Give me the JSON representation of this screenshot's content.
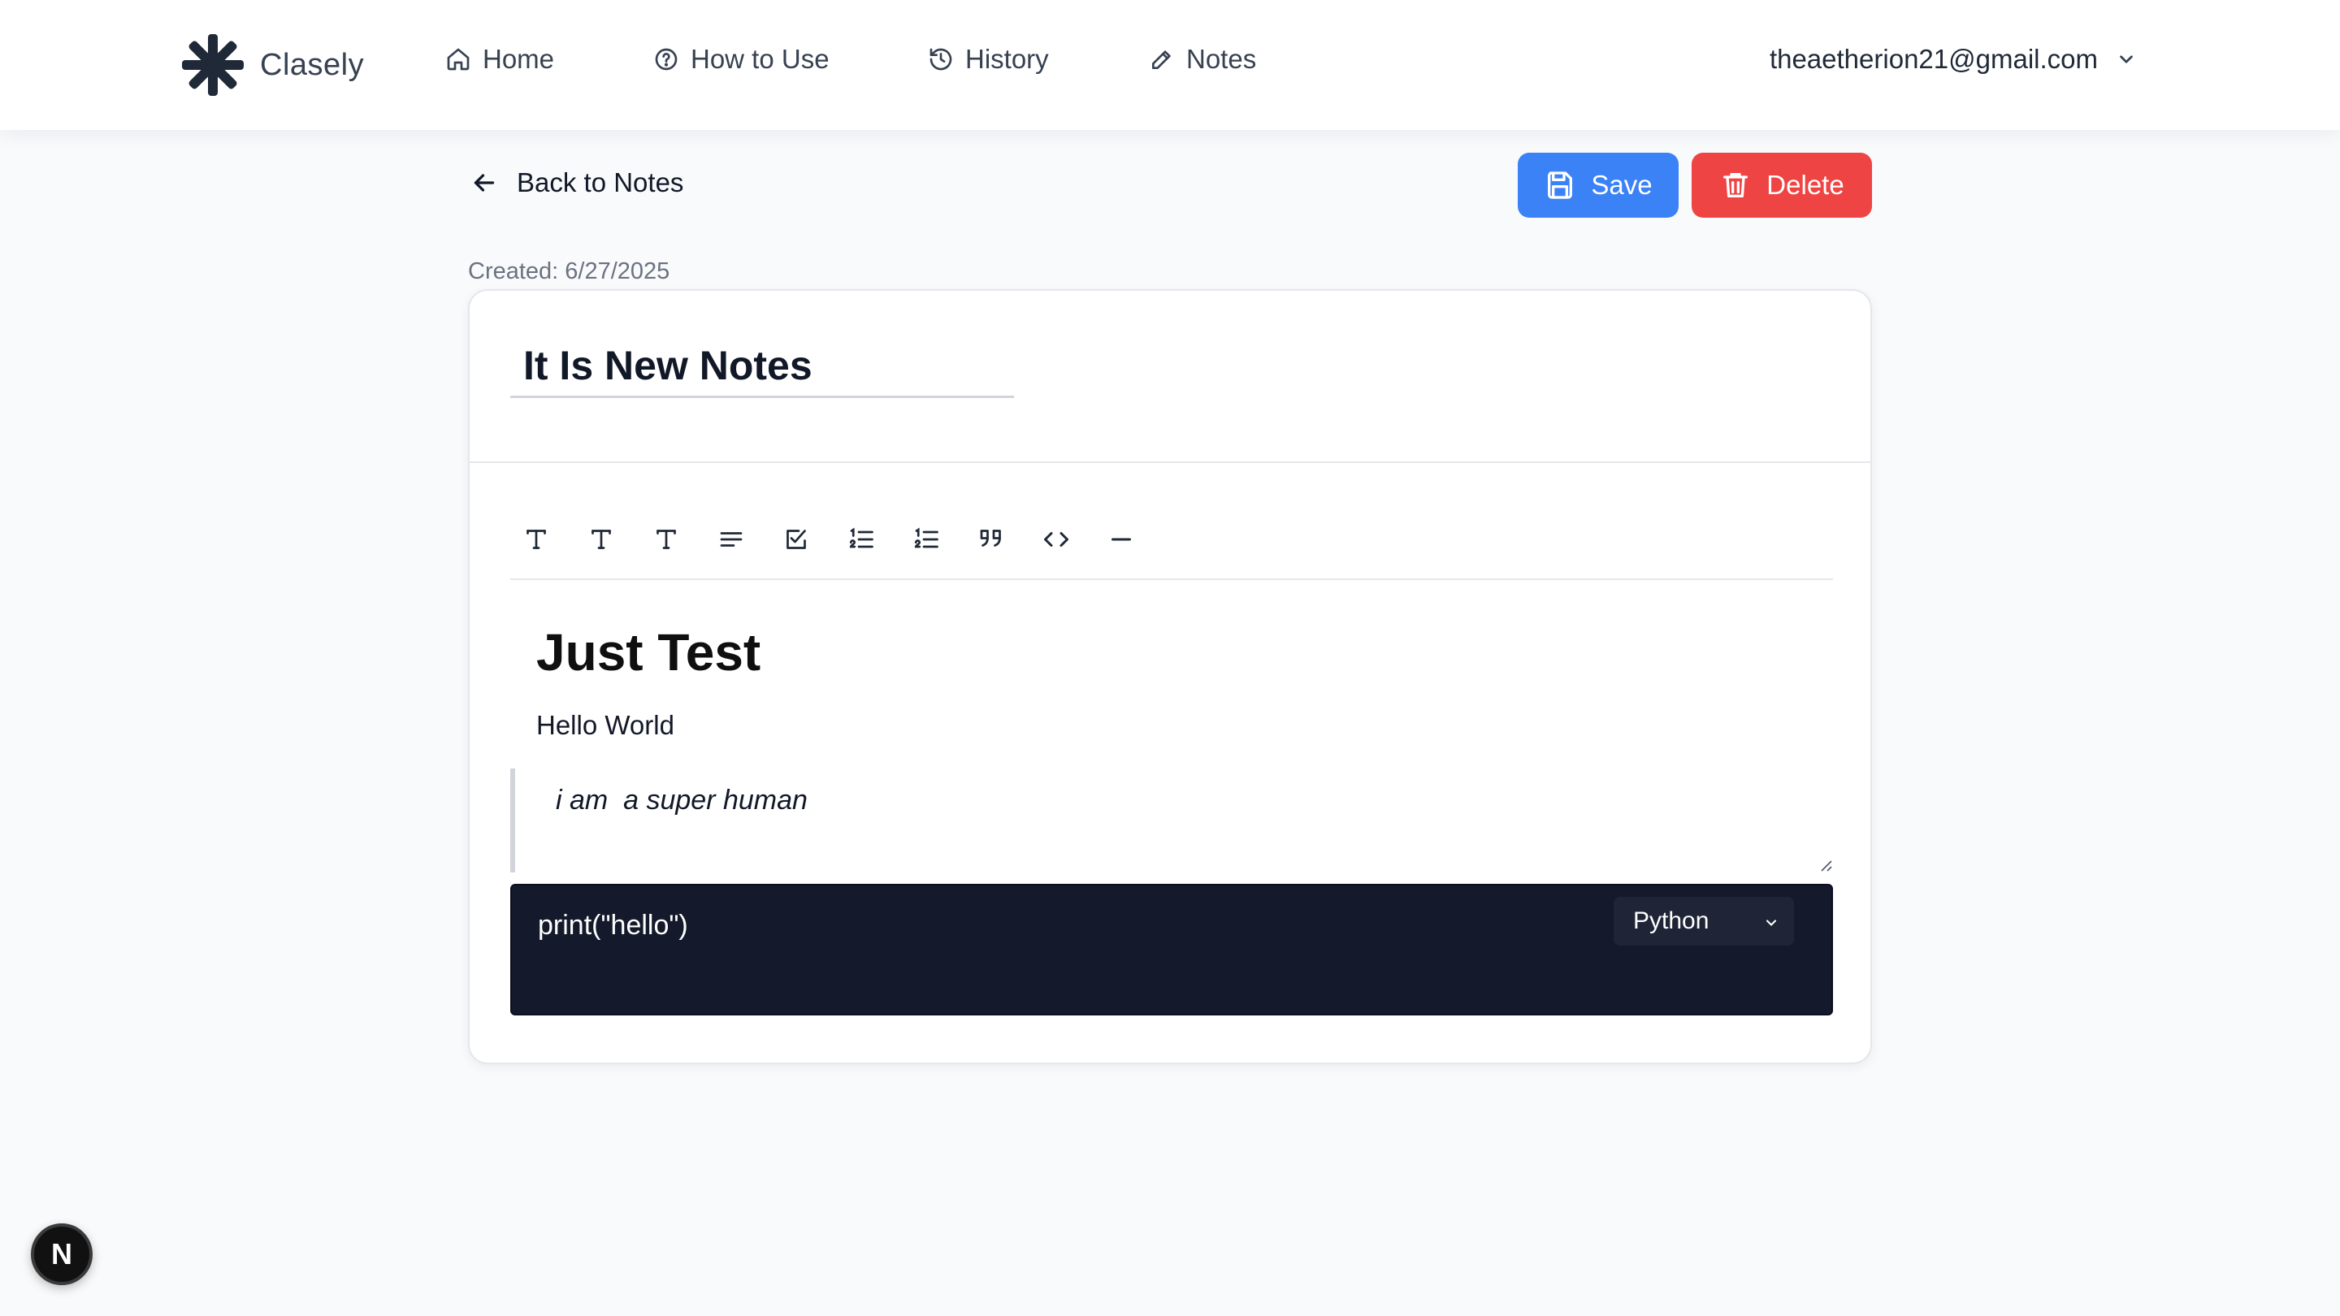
{
  "header": {
    "brand": "Clasely",
    "nav": [
      {
        "label": "Home",
        "icon": "home-icon"
      },
      {
        "label": "How to Use",
        "icon": "help-circle-icon"
      },
      {
        "label": "History",
        "icon": "history-icon"
      },
      {
        "label": "Notes",
        "icon": "pencil-icon"
      }
    ],
    "user_email": "theaetherion21@gmail.com"
  },
  "actions": {
    "back_label": "Back to Notes",
    "save_label": "Save",
    "delete_label": "Delete"
  },
  "note": {
    "created": "Created: 6/27/2025",
    "title": "It Is New Notes",
    "heading": "Just Test",
    "paragraph": "Hello World",
    "quote": "i am  a super human",
    "code": "print(\"hello\")",
    "code_language": "Python"
  },
  "toolbar": {
    "tools": [
      "heading-1-icon",
      "heading-2-icon",
      "heading-3-icon",
      "paragraph-icon",
      "checklist-icon",
      "ordered-list-icon",
      "bullet-list-icon",
      "quote-icon",
      "code-icon",
      "divider-icon"
    ]
  },
  "badge": {
    "label": "N"
  },
  "colors": {
    "primary": "#3b82f6",
    "danger": "#ef4444",
    "code_bg": "#141a2b",
    "page_bg": "#f8fafc"
  }
}
